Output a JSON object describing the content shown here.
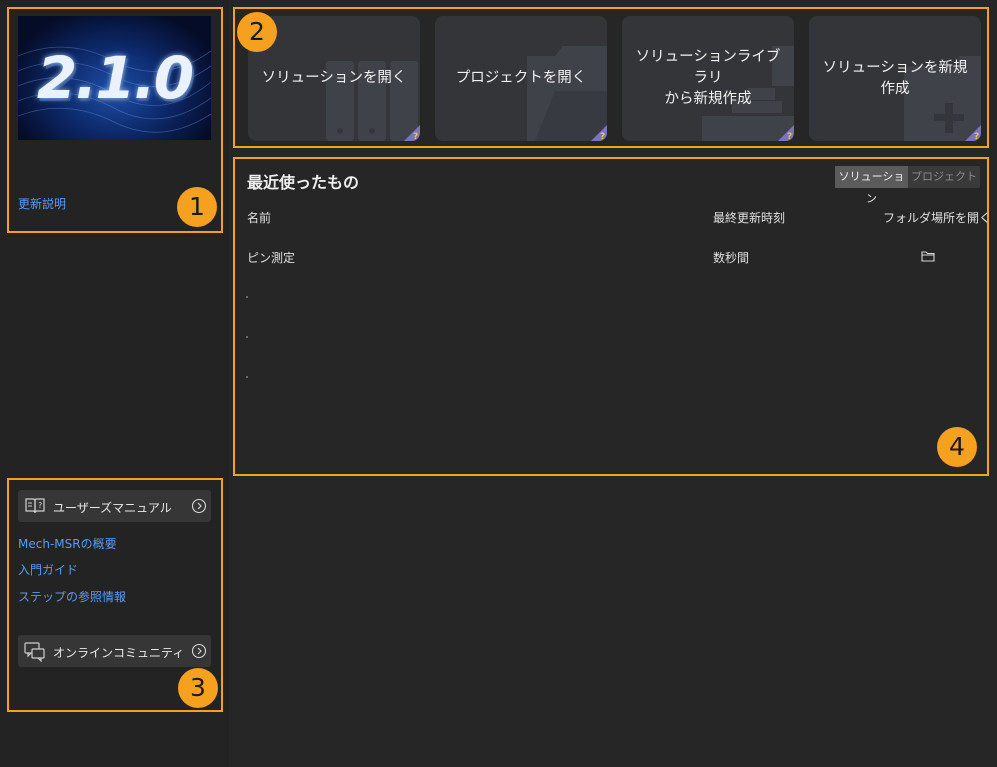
{
  "sidebar": {
    "version_label": "2.1.0",
    "release_notes_link": "更新説明",
    "user_manual": {
      "label": "ユーザーズマニュアル",
      "icon": "manual-book-icon"
    },
    "links": [
      "Mech-MSRの概要",
      "入門ガイド",
      "ステップの参照情報"
    ],
    "community": {
      "label": "オンラインコミュニティ",
      "icon": "chat-bubble-icon"
    }
  },
  "actions": {
    "cards": [
      {
        "label": "ソリューションを開く",
        "icon": "cabinet-icon"
      },
      {
        "label": "プロジェクトを開く",
        "icon": "folder-icon"
      },
      {
        "label": "ソリューションライブラリ\nから新規作成",
        "icon": "library-icon"
      },
      {
        "label": "ソリューションを新規\n作成",
        "icon": "new-solution-icon"
      }
    ],
    "help_badge": "?"
  },
  "recent": {
    "title": "最近使ったもの",
    "toggle": {
      "active": "ソリューション",
      "inactive": "プロジェクト"
    },
    "columns": {
      "name": "名前",
      "updated": "最終更新時刻",
      "open_folder": "フォルダ場所を開く"
    },
    "rows": [
      {
        "name": "ピン測定",
        "updated": "数秒間"
      }
    ]
  },
  "annotations": [
    "1",
    "2",
    "3",
    "4"
  ],
  "colors": {
    "annotation": "#f5a01e",
    "link": "#5b9bf0",
    "sidebar_bg": "#232323",
    "main_bg": "#262626",
    "card_bg": "#343539"
  }
}
